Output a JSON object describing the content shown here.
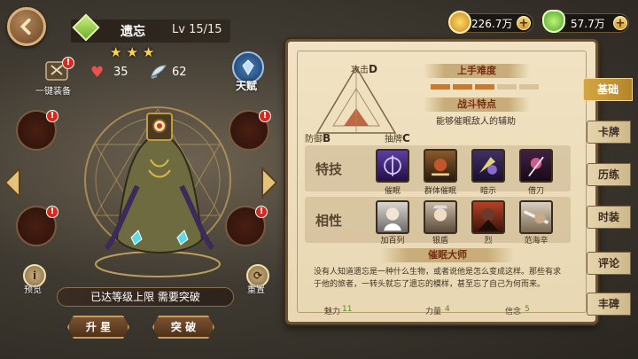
{
  "hero": {
    "name": "遗忘",
    "level": "Lv 15/15",
    "stars": "★★★",
    "hp": "35",
    "speed": "62"
  },
  "left_menu": {
    "equip_label": "一键装备",
    "talent_label": "天赋",
    "preview_label": "预览",
    "reset_label": "重置",
    "limit_text": "已达等级上限 需要突破",
    "star_up_label": "升 星",
    "breakthrough_label": "突 破",
    "red_badge": "!"
  },
  "currency": {
    "gold": "226.7万",
    "gem": "57.7万",
    "plus": "+"
  },
  "panel": {
    "triangle": {
      "attack_label": "攻击",
      "attack_grade": "D",
      "defense_label": "防御",
      "defense_grade": "B",
      "control_label": "抽牌",
      "control_grade": "C"
    },
    "difficulty_title": "上手难度",
    "difficulty_level": 3,
    "difficulty_max": 5,
    "feature_title": "战斗特点",
    "feature_text": "能够催眠敌人的辅助",
    "skills_label": "特技",
    "skills": [
      {
        "name": "催眠",
        "icon": "hypnosis-icon"
      },
      {
        "name": "群体催眠",
        "icon": "mass-hypnosis-icon"
      },
      {
        "name": "暗示",
        "icon": "suggestion-icon"
      },
      {
        "name": "借刀",
        "icon": "borrow-blade-icon"
      }
    ],
    "relations_label": "相性",
    "relations": [
      {
        "name": "加百列",
        "icon": "gabriel-portrait"
      },
      {
        "name": "银盾",
        "icon": "silver-shield-portrait"
      },
      {
        "name": "烈",
        "icon": "lie-portrait"
      },
      {
        "name": "范海辛",
        "icon": "van-helsing-portrait"
      }
    ],
    "bio_title": "催眠大师",
    "bio_text": "没有人知道遗忘是一种什么生物，或者说他是怎么变成这样。那些有求于他的旅者，一转头就忘了遗忘的模样，甚至忘了自己为何而来。",
    "stats": [
      {
        "key": "魅力",
        "value": "11"
      },
      {
        "key": "力量",
        "value": "4"
      },
      {
        "key": "信念",
        "value": "5"
      }
    ]
  },
  "tabs": [
    "基础",
    "卡牌",
    "历练",
    "时装",
    "评论",
    "丰碑"
  ],
  "active_tab": 0,
  "colors": {
    "accent_gold": "#d4a742",
    "parchment": "#efe0bf",
    "difficulty_on": "#c97a2e",
    "difficulty_off": "#d8c49c",
    "stat_green": "#5b8a28"
  }
}
